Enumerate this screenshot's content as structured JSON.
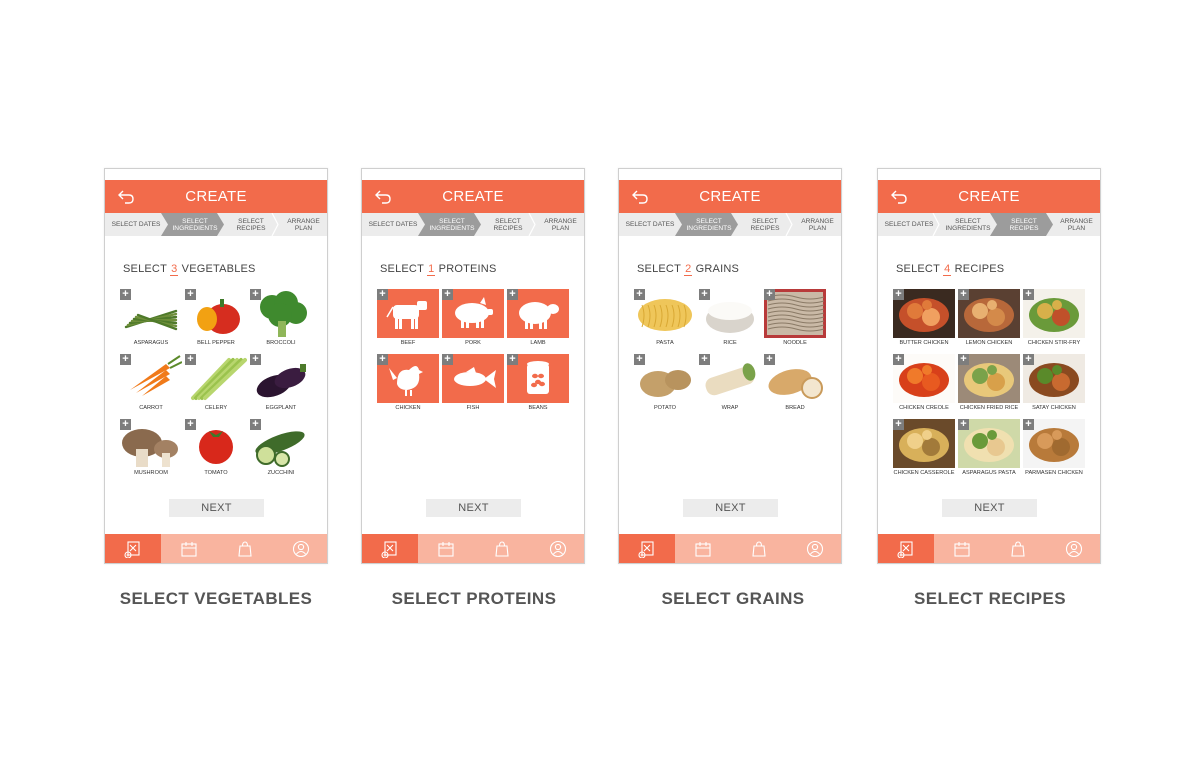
{
  "colors": {
    "accent": "#f26b4b",
    "accent_light": "#f9b49f",
    "step_active": "#9c9c9c",
    "button_bg": "#ececec"
  },
  "screens": [
    {
      "title": "CREATE",
      "steps": [
        "SELECT DATES",
        "SELECT INGREDIENTS",
        "SELECT RECIPES",
        "ARRANGE PLAN"
      ],
      "active_step": 1,
      "heading_prefix": "SELECT",
      "heading_count": "3",
      "heading_suffix": "VEGETABLES",
      "tile_kind": "photo",
      "items": [
        {
          "label": "ASPARAGUS",
          "icon": "asparagus-photo"
        },
        {
          "label": "BELL PEPPER",
          "icon": "bell-pepper-photo"
        },
        {
          "label": "BROCCOLI",
          "icon": "broccoli-photo"
        },
        {
          "label": "CARROT",
          "icon": "carrot-photo"
        },
        {
          "label": "CELERY",
          "icon": "celery-photo"
        },
        {
          "label": "EGGPLANT",
          "icon": "eggplant-photo"
        },
        {
          "label": "MUSHROOM",
          "icon": "mushroom-photo"
        },
        {
          "label": "TOMATO",
          "icon": "tomato-photo"
        },
        {
          "label": "ZUCCHINI",
          "icon": "zucchini-photo"
        }
      ],
      "next_label": "NEXT",
      "caption": "SELECT VEGETABLES"
    },
    {
      "title": "CREATE",
      "steps": [
        "SELECT DATES",
        "SELECT INGREDIENTS",
        "SELECT RECIPES",
        "ARRANGE PLAN"
      ],
      "active_step": 1,
      "heading_prefix": "SELECT",
      "heading_count": "1",
      "heading_suffix": "PROTEINS",
      "tile_kind": "protein",
      "items": [
        {
          "label": "BEEF",
          "icon": "cow-icon"
        },
        {
          "label": "PORK",
          "icon": "pig-icon"
        },
        {
          "label": "LAMB",
          "icon": "sheep-icon"
        },
        {
          "label": "CHICKEN",
          "icon": "chicken-icon"
        },
        {
          "label": "FISH",
          "icon": "fish-icon"
        },
        {
          "label": "BEANS",
          "icon": "bean-can-icon"
        }
      ],
      "next_label": "NEXT",
      "caption": "SELECT PROTEINS"
    },
    {
      "title": "CREATE",
      "steps": [
        "SELECT DATES",
        "SELECT INGREDIENTS",
        "SELECT RECIPES",
        "ARRANGE PLAN"
      ],
      "active_step": 1,
      "heading_prefix": "SELECT",
      "heading_count": "2",
      "heading_suffix": "GRAINS",
      "tile_kind": "photo",
      "items": [
        {
          "label": "PASTA",
          "icon": "pasta-photo"
        },
        {
          "label": "RICE",
          "icon": "rice-photo"
        },
        {
          "label": "NOODLE",
          "icon": "noodle-photo"
        },
        {
          "label": "POTATO",
          "icon": "potato-photo"
        },
        {
          "label": "WRAP",
          "icon": "wrap-photo"
        },
        {
          "label": "BREAD",
          "icon": "bread-photo"
        }
      ],
      "next_label": "NEXT",
      "caption": "SELECT GRAINS"
    },
    {
      "title": "CREATE",
      "steps": [
        "SELECT DATES",
        "SELECT INGREDIENTS",
        "SELECT RECIPES",
        "ARRANGE PLAN"
      ],
      "active_step": 2,
      "heading_prefix": "SELECT",
      "heading_count": "4",
      "heading_suffix": "RECIPES",
      "tile_kind": "photo",
      "items": [
        {
          "label": "BUTTER CHICKEN",
          "icon": "butter-chicken-photo"
        },
        {
          "label": "LEMON CHICKEN",
          "icon": "lemon-chicken-photo"
        },
        {
          "label": "CHICKEN STIR-FRY",
          "icon": "chicken-stir-fry-photo"
        },
        {
          "label": "CHICKEN CREOLE",
          "icon": "chicken-creole-photo"
        },
        {
          "label": "CHICKEN FRIED RICE",
          "icon": "chicken-fried-rice-photo"
        },
        {
          "label": "SATAY CHICKEN",
          "icon": "satay-chicken-photo"
        },
        {
          "label": "CHICKEN CASSEROLE",
          "icon": "chicken-casserole-photo"
        },
        {
          "label": "ASPARAGUS PASTA",
          "icon": "asparagus-pasta-photo"
        },
        {
          "label": "PARMASEN CHICKEN",
          "icon": "parmasen-chicken-photo"
        }
      ],
      "next_label": "NEXT",
      "caption": "SELECT RECIPES"
    }
  ],
  "bottom_nav": [
    {
      "icon": "create-plan-icon",
      "active": true
    },
    {
      "icon": "calendar-icon",
      "active": false
    },
    {
      "icon": "shopping-bag-icon",
      "active": false
    },
    {
      "icon": "profile-icon",
      "active": false
    }
  ],
  "add_symbol": "+"
}
